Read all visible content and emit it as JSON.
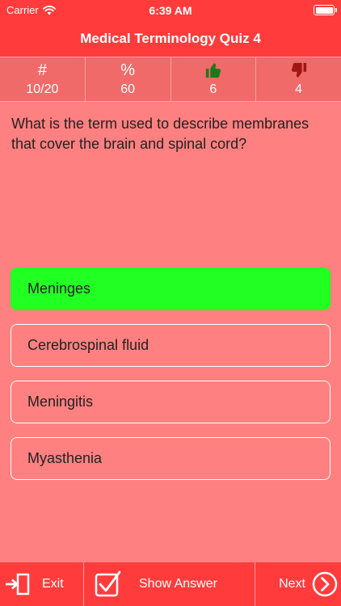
{
  "status": {
    "carrier": "Carrier",
    "time": "6:39 AM"
  },
  "nav": {
    "title": "Medical Terminology Quiz 4"
  },
  "stats": [
    {
      "symbol": "#",
      "value": "10/20",
      "icon": "hash-icon"
    },
    {
      "symbol": "%",
      "value": "60",
      "icon": "percent-icon"
    },
    {
      "symbol": "",
      "value": "6",
      "icon": "thumbs-up-icon",
      "color": "#1a7a1a"
    },
    {
      "symbol": "",
      "value": "4",
      "icon": "thumbs-down-icon",
      "color": "#a31515"
    }
  ],
  "question": "What is the term used to describe membranes that cover the brain and spinal cord?",
  "answers": [
    {
      "label": "Meninges",
      "state": "correct"
    },
    {
      "label": "Cerebrospinal fluid",
      "state": "normal"
    },
    {
      "label": "Meningitis",
      "state": "normal"
    },
    {
      "label": "Myasthenia",
      "state": "normal"
    }
  ],
  "toolbar": {
    "exit_label": "Exit",
    "show_answer_label": "Show Answer",
    "next_label": "Next"
  },
  "colors": {
    "header": "#ff3b3b",
    "background": "#ff8080",
    "correct": "#22ff22"
  }
}
